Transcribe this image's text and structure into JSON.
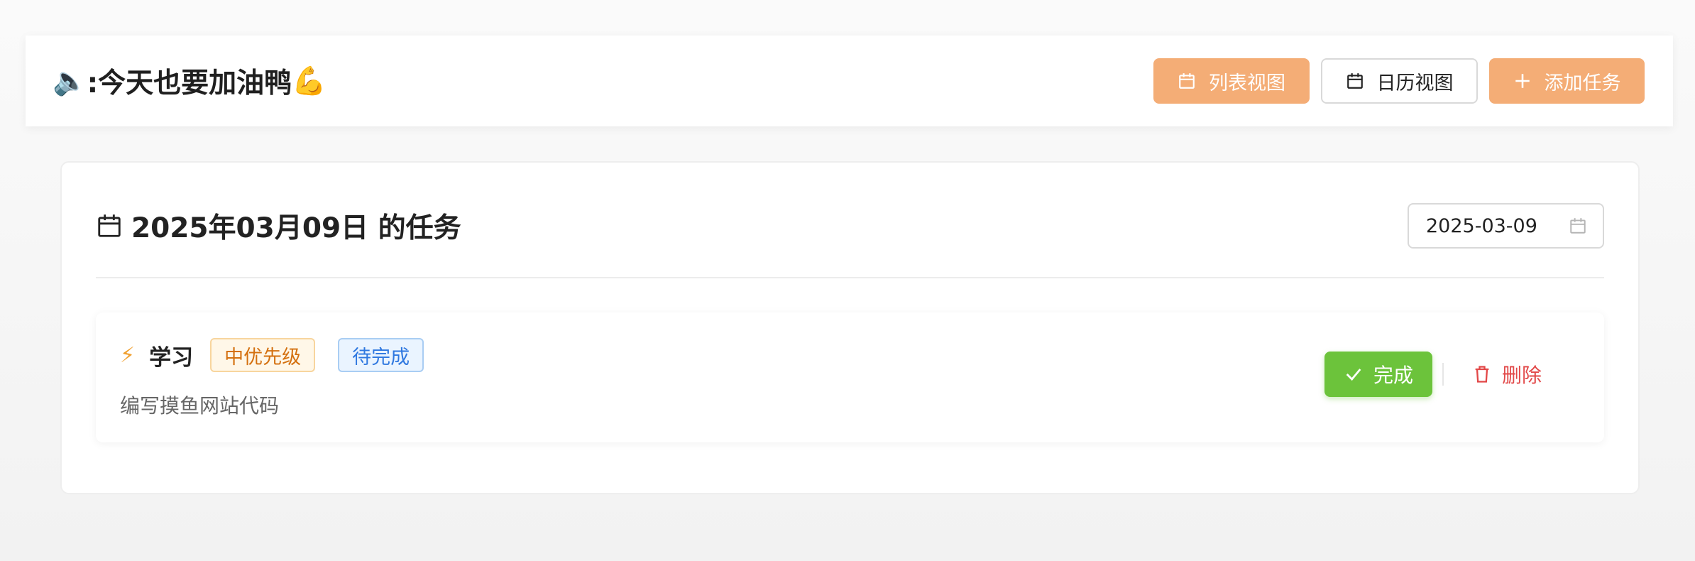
{
  "header": {
    "title_emoji_left": "🔈",
    "title_text": ":今天也要加油鸭",
    "title_emoji_right": "💪",
    "buttons": {
      "list_view": "列表视图",
      "calendar_view": "日历视图",
      "add_task": "添加任务"
    }
  },
  "main": {
    "heading": "2025年03月09日 的任务",
    "date_value": "2025-03-09"
  },
  "tasks": [
    {
      "icon": "⚡",
      "title": "学习",
      "priority": "中优先级",
      "status": "待完成",
      "description": "编写摸鱼网站代码",
      "complete_label": "完成",
      "delete_label": "删除"
    }
  ],
  "colors": {
    "orange": "#f4ad76",
    "green": "#6cc33b",
    "red": "#e24848",
    "blue": "#2f78e0"
  }
}
